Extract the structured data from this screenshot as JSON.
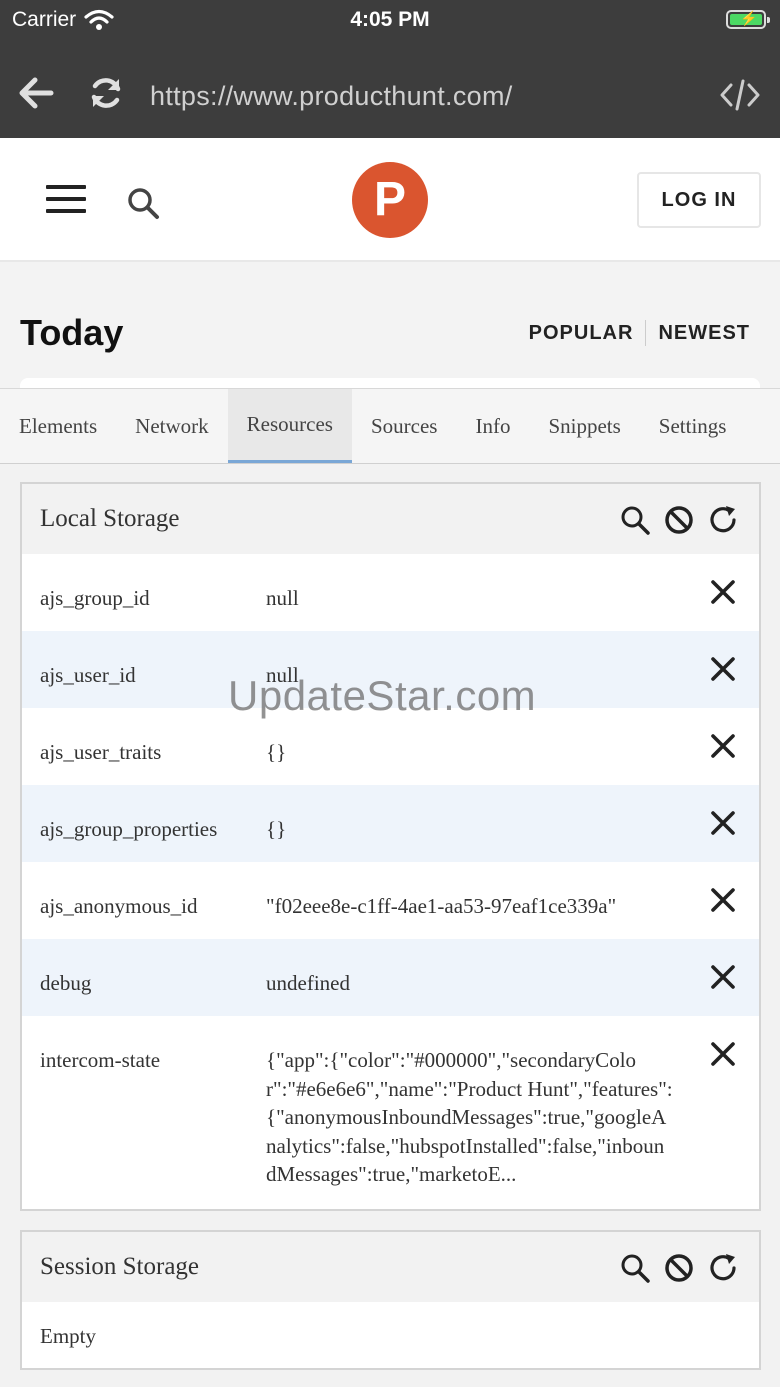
{
  "status_bar": {
    "carrier": "Carrier",
    "time": "4:05 PM"
  },
  "browser": {
    "url": "https://www.producthunt.com/"
  },
  "site": {
    "logo_letter": "P",
    "login_label": "LOG IN",
    "heading": "Today",
    "sort": {
      "popular": "POPULAR",
      "newest": "NEWEST"
    }
  },
  "devtools": {
    "tabs": [
      {
        "label": "Elements"
      },
      {
        "label": "Network"
      },
      {
        "label": "Resources",
        "active": true
      },
      {
        "label": "Sources"
      },
      {
        "label": "Info"
      },
      {
        "label": "Snippets"
      },
      {
        "label": "Settings"
      }
    ],
    "local_storage": {
      "title": "Local Storage",
      "rows": [
        {
          "key": "ajs_group_id",
          "value": "null"
        },
        {
          "key": "ajs_user_id",
          "value": "null"
        },
        {
          "key": "ajs_user_traits",
          "value": "{}"
        },
        {
          "key": "ajs_group_properties",
          "value": "{}"
        },
        {
          "key": "ajs_anonymous_id",
          "value": "\"f02eee8e-c1ff-4ae1-aa53-97eaf1ce339a\""
        },
        {
          "key": "debug",
          "value": "undefined"
        },
        {
          "key": "intercom-state",
          "value": "{\"app\":{\"color\":\"#000000\",\"secondaryColor\":\"#e6e6e6\",\"name\":\"Product Hunt\",\"features\":{\"anonymousInboundMessages\":true,\"googleAnalytics\":false,\"hubspotInstalled\":false,\"inboundMessages\":true,\"marketoE..."
        }
      ]
    },
    "session_storage": {
      "title": "Session Storage",
      "empty_label": "Empty"
    }
  },
  "watermark": "UpdateStar.com",
  "colors": {
    "brand": "#da552f",
    "chrome": "#3d3d3d",
    "active_tab_underline": "#7aa7d6",
    "alt_row": "#eef4fb"
  }
}
